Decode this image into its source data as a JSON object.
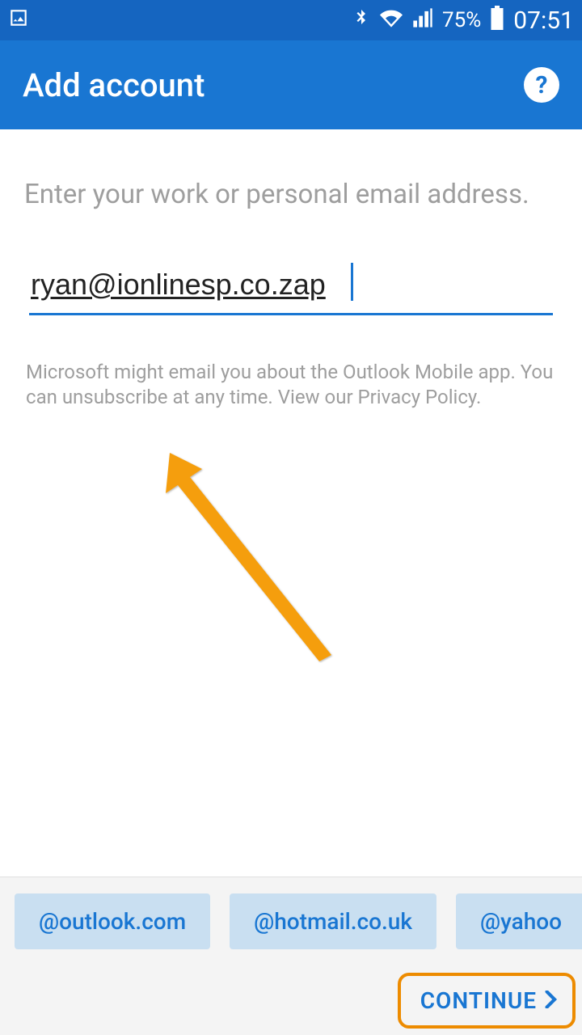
{
  "status": {
    "battery_pct": "75%",
    "time": "07:51"
  },
  "appbar": {
    "title": "Add account"
  },
  "main": {
    "prompt": "Enter your work or personal email address.",
    "email_value": "ryan@ionlinesp.co.zap",
    "disclaimer": "Microsoft might email you about the Outlook Mobile app. You can unsubscribe at any time. View our Privacy Policy."
  },
  "suggestions": [
    "@outlook.com",
    "@hotmail.co.uk",
    "@yahoo"
  ],
  "footer": {
    "continue_label": "CONTINUE"
  },
  "colors": {
    "status_bg": "#1565c0",
    "appbar_bg": "#1976d2",
    "accent": "#1976d2",
    "annotation": "#ed8b00",
    "suggest_bg": "#c9dff1"
  }
}
